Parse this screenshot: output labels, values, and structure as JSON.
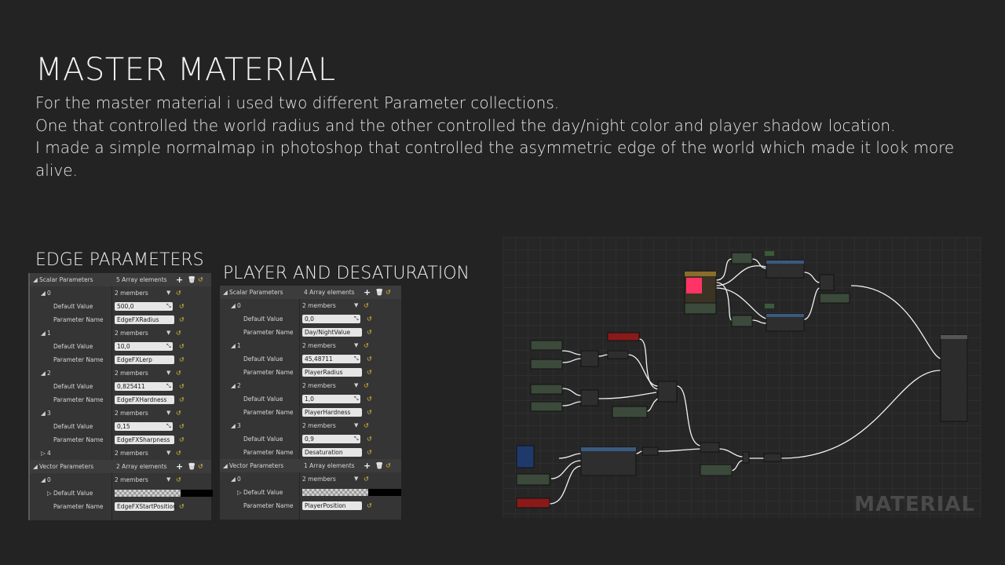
{
  "title": "MASTER MATERIAL",
  "description": [
    "For the master material i used two different Parameter collections.",
    "One that controlled the world radius and the other controlled the day/night color and player shadow location.",
    "I made a simple normalmap in photoshop that controlled the asymmetric edge of the world which made it look more",
    "alive."
  ],
  "edge": {
    "title": "EDGE PARAMETERS",
    "scalar_label": "Scalar Parameters",
    "scalar_count": "5 Array elements",
    "vector_label": "Vector Parameters",
    "vector_count": "2 Array elements",
    "members": "2 members",
    "default_value_label": "Default Value",
    "parameter_name_label": "Parameter Name",
    "items": [
      {
        "index": "0",
        "value": "500,0",
        "name": "EdgeFXRadius"
      },
      {
        "index": "1",
        "value": "10,0",
        "name": "EdgeFXLerp"
      },
      {
        "index": "2",
        "value": "0,825411",
        "name": "EdgeFXHardness"
      },
      {
        "index": "3",
        "value": "0,15",
        "name": "EdgeFXSharpness"
      }
    ],
    "collapsed_index": "4",
    "vector_index": "0",
    "vector_name": "EdgeFXStartPosition"
  },
  "player": {
    "title": "PLAYER AND DESATURATION",
    "scalar_label": "Scalar Parameters",
    "scalar_count": "4 Array elements",
    "vector_label": "Vector Parameters",
    "vector_count": "1 Array elements",
    "members": "2 members",
    "default_value_label": "Default Value",
    "parameter_name_label": "Parameter Name",
    "items": [
      {
        "index": "0",
        "value": "0,0",
        "name": "Day/NightValue"
      },
      {
        "index": "1",
        "value": "45,48711",
        "name": "PlayerRadius"
      },
      {
        "index": "2",
        "value": "1,0",
        "name": "PlayerHardness"
      },
      {
        "index": "3",
        "value": "0,9",
        "name": "Desaturation"
      }
    ],
    "vector_index": "0",
    "vector_name": "PlayerPosition"
  },
  "graph": {
    "watermark": "MATERIAL",
    "colors": {
      "bg": "#262626",
      "node": "#3a4a3a",
      "wire": "#f0f0f0",
      "red_node": "#8a1a1a",
      "swatch": "#ff3366"
    }
  }
}
